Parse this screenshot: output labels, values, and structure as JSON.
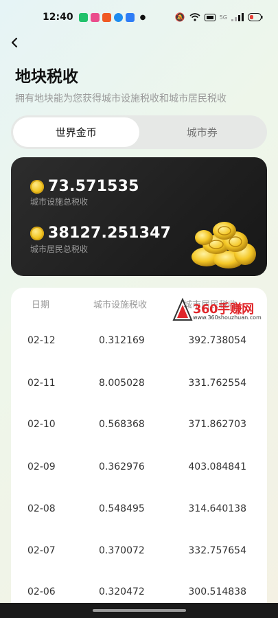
{
  "status_bar": {
    "time": "12:40",
    "network_label": "5G",
    "app_icons": [
      "green-app-icon",
      "pink-app-icon",
      "orange-app-icon",
      "blue-app-icon",
      "blue-app-icon-2"
    ],
    "right_icons": [
      "mute-icon",
      "wifi-icon",
      "battery-saver-icon",
      "signal-icon",
      "battery-icon"
    ]
  },
  "header": {
    "title": "地块税收",
    "subtitle": "拥有地块能为您获得城市设施税收和城市居民税收"
  },
  "tabs": [
    {
      "label": "世界金币",
      "active": true
    },
    {
      "label": "城市券",
      "active": false
    }
  ],
  "summary": {
    "facility_tax_value": "73.571535",
    "facility_tax_label": "城市设施总税收",
    "resident_tax_value": "38127.251347",
    "resident_tax_label": "城市居民总税收"
  },
  "table": {
    "headers": [
      "日期",
      "城市设施税收",
      "城市居民税收"
    ],
    "rows": [
      {
        "date": "02-12",
        "facility": "0.312169",
        "resident": "392.738054"
      },
      {
        "date": "02-11",
        "facility": "8.005028",
        "resident": "331.762554"
      },
      {
        "date": "02-10",
        "facility": "0.568368",
        "resident": "371.862703"
      },
      {
        "date": "02-09",
        "facility": "0.362976",
        "resident": "403.084841"
      },
      {
        "date": "02-08",
        "facility": "0.548495",
        "resident": "314.640138"
      },
      {
        "date": "02-07",
        "facility": "0.370072",
        "resident": "332.757654"
      },
      {
        "date": "02-06",
        "facility": "0.320472",
        "resident": "300.514838"
      }
    ]
  },
  "watermark": {
    "brand": "360手赚网",
    "url": "www.360shouzhuan.com"
  }
}
